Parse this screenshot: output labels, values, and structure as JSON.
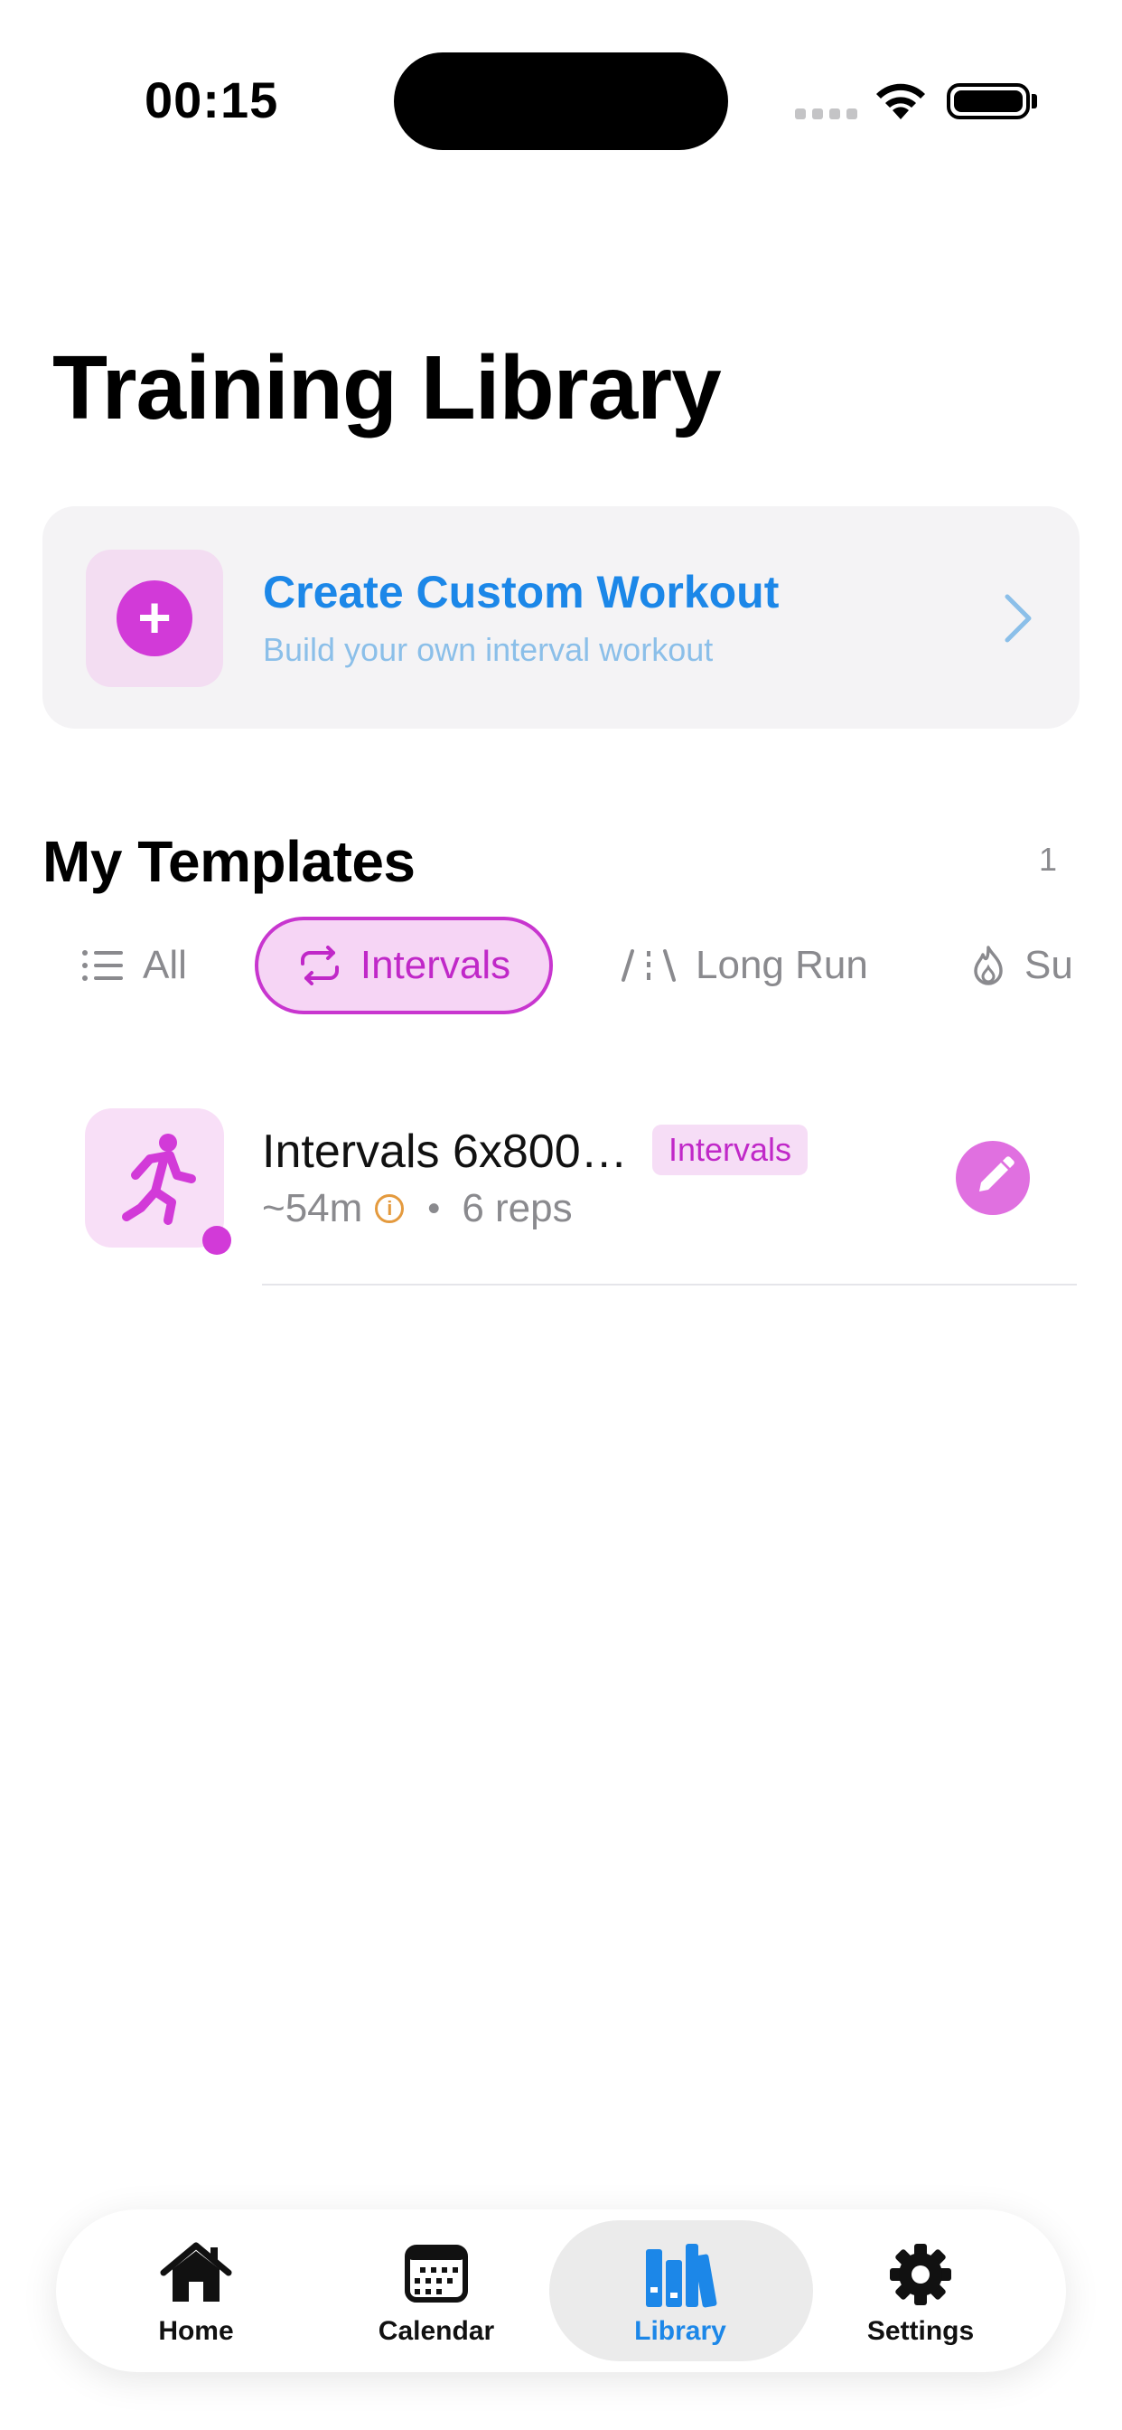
{
  "status_bar": {
    "time": "00:15"
  },
  "page": {
    "title": "Training Library"
  },
  "create_card": {
    "title": "Create Custom Workout",
    "subtitle": "Build your own interval workout"
  },
  "section": {
    "title": "My Templates",
    "count": "1"
  },
  "filters": [
    {
      "label": "All",
      "icon": "list-icon",
      "selected": false
    },
    {
      "label": "Intervals",
      "icon": "repeat-icon",
      "selected": true
    },
    {
      "label": "Long Run",
      "icon": "road-icon",
      "selected": false
    },
    {
      "label": "Su",
      "icon": "flame-icon",
      "selected": false
    }
  ],
  "templates": [
    {
      "name": "Intervals 6x800…",
      "badge": "Intervals",
      "duration": "~54m",
      "bullet": "•",
      "reps": "6 reps",
      "icon": "runner-icon"
    }
  ],
  "tabbar": {
    "items": [
      {
        "label": "Home",
        "icon": "house-icon"
      },
      {
        "label": "Calendar",
        "icon": "calendar-icon"
      },
      {
        "label": "Library",
        "icon": "books-icon",
        "selected": true
      },
      {
        "label": "Settings",
        "icon": "gear-icon"
      }
    ]
  },
  "colors": {
    "accent_blue": "#1c87e8",
    "accent_magenta": "#d23ad8",
    "chip_bg": "#f6d5f5",
    "info_orange": "#e49a3e"
  }
}
